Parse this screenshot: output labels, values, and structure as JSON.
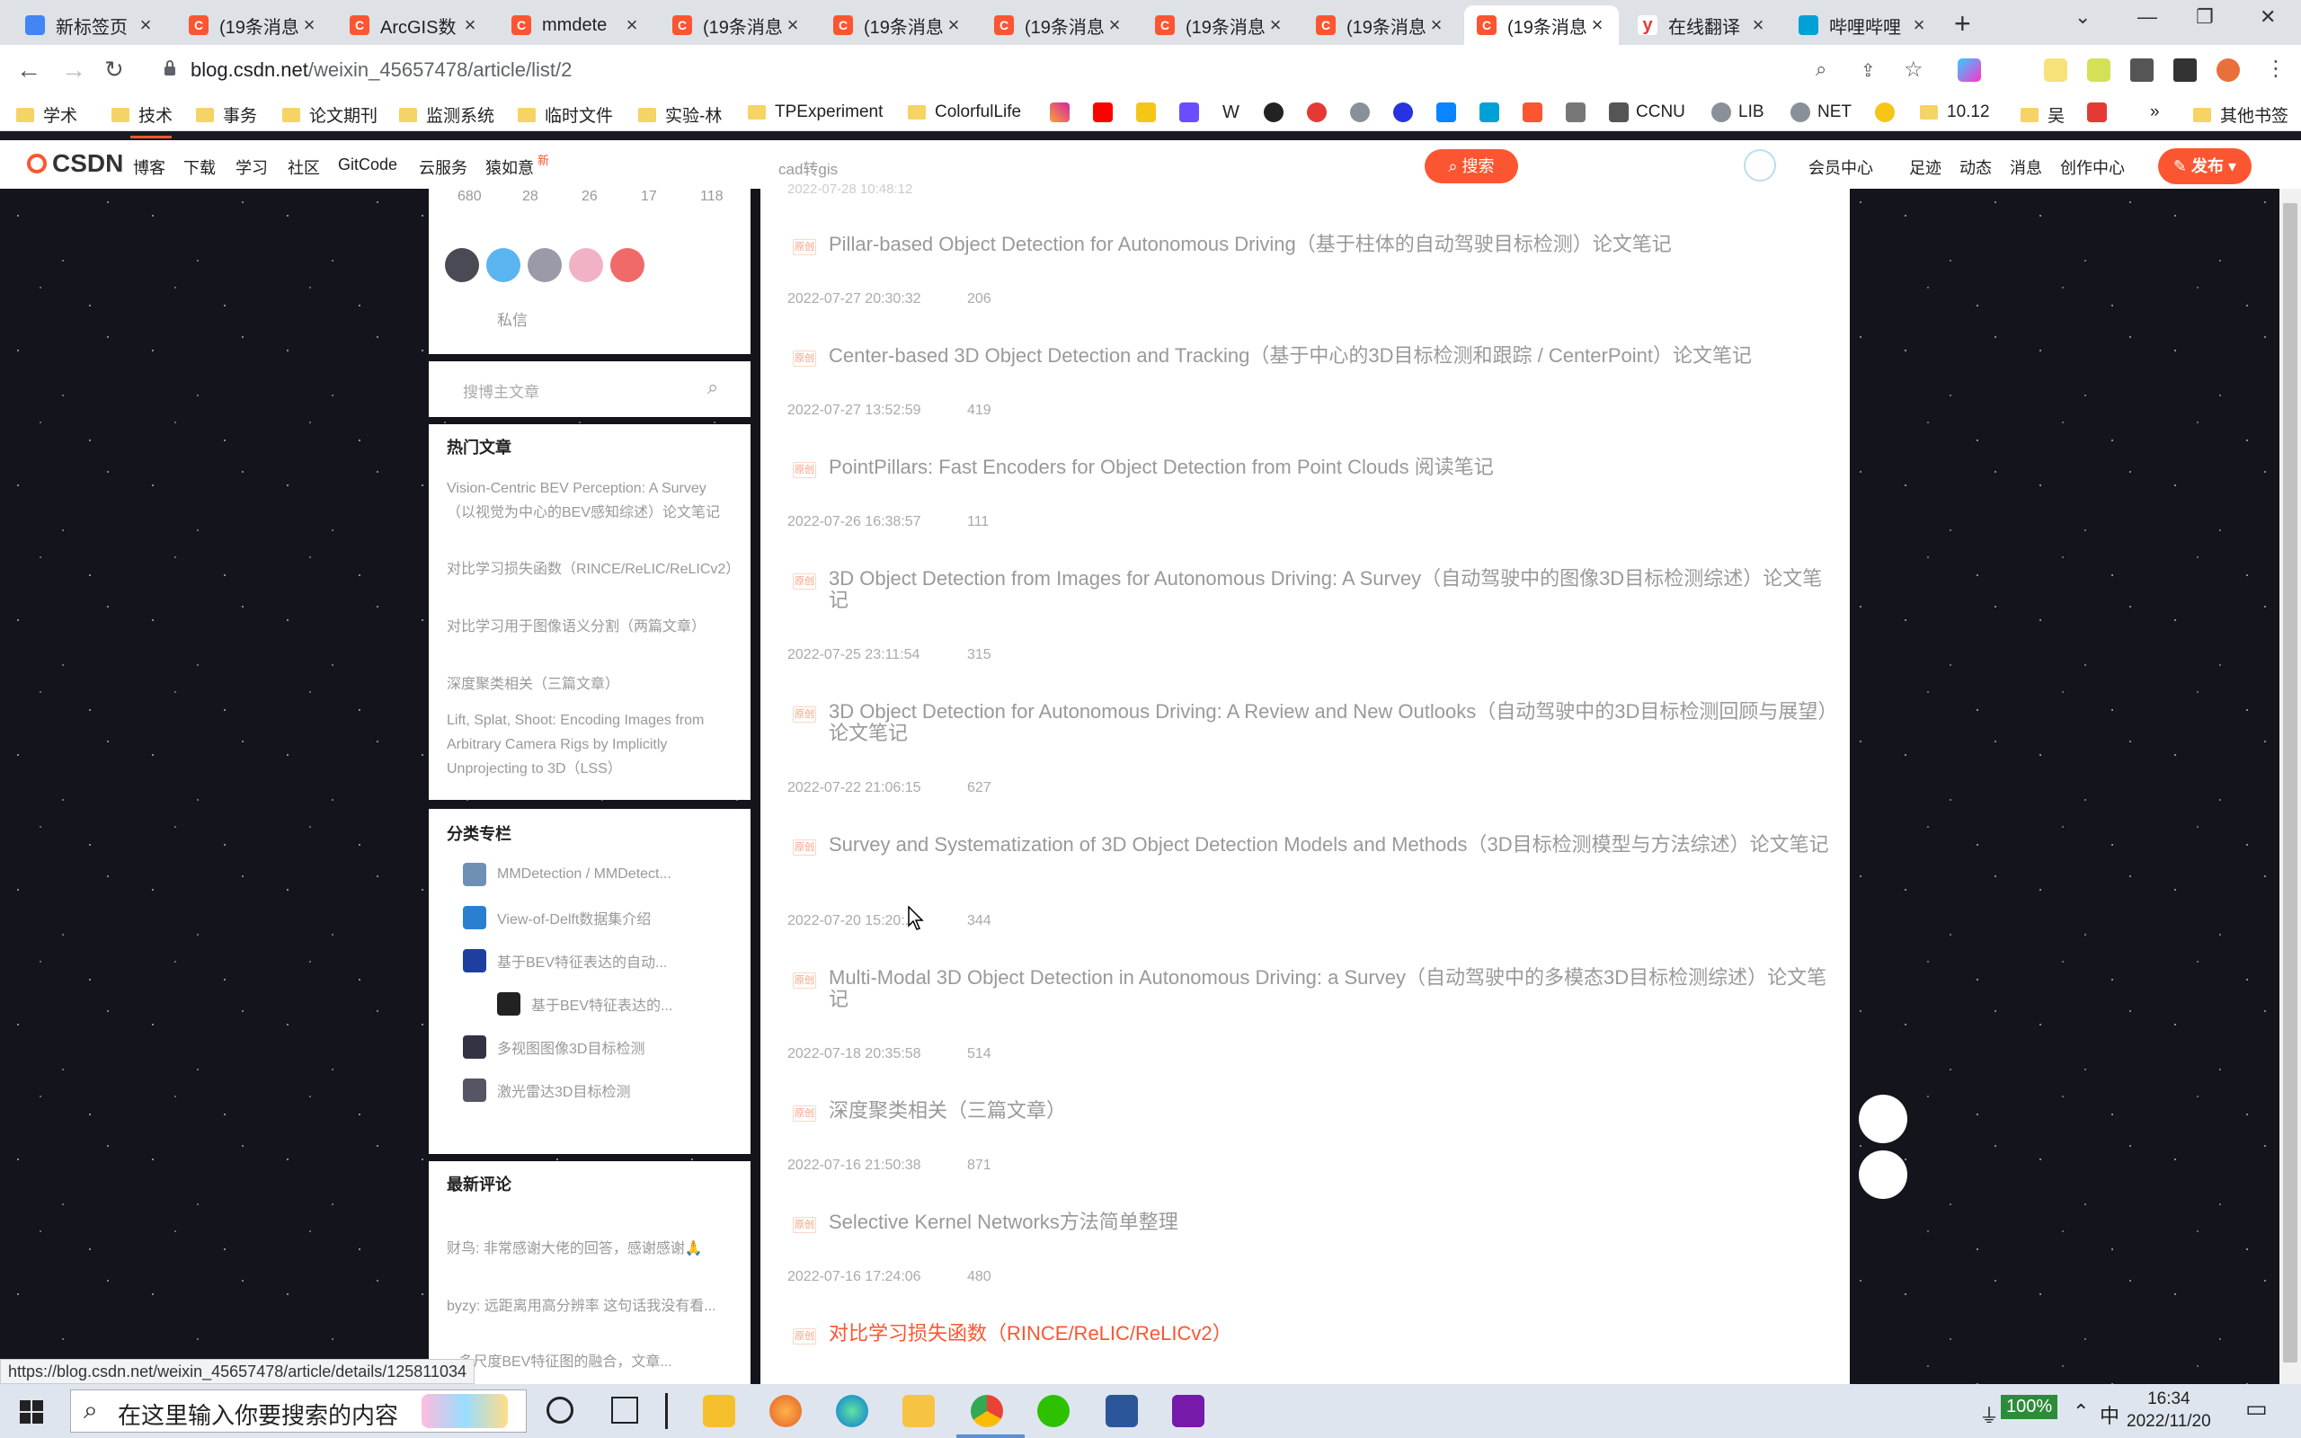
{
  "browser": {
    "tabs": [
      {
        "title": "新标签页",
        "color": "#4285f4",
        "glyph": "◉"
      },
      {
        "title": "(19条消息",
        "color": "#fc5531",
        "glyph": "C"
      },
      {
        "title": "ArcGIS数",
        "color": "#fc5531",
        "glyph": "C"
      },
      {
        "title": "mmdete",
        "color": "#fc5531",
        "glyph": "C"
      },
      {
        "title": "(19条消息",
        "color": "#fc5531",
        "glyph": "C"
      },
      {
        "title": "(19条消息",
        "color": "#fc5531",
        "glyph": "C"
      },
      {
        "title": "(19条消息",
        "color": "#fc5531",
        "glyph": "C"
      },
      {
        "title": "(19条消息",
        "color": "#fc5531",
        "glyph": "C"
      },
      {
        "title": "(19条消息",
        "color": "#fc5531",
        "glyph": "C"
      },
      {
        "title": "(19条消息",
        "color": "#fc5531",
        "glyph": "C"
      },
      {
        "title": "在线翻译",
        "color": "#e53935",
        "glyph": "y"
      },
      {
        "title": "哔哩哔哩",
        "color": "#00a1d6",
        "glyph": "▣"
      }
    ],
    "url_host": "blog.csdn.net",
    "url_path": "/weixin_45657478/article/list/2",
    "bookmarks": [
      "学术",
      "技术",
      "事务",
      "论文期刊",
      "监测系统",
      "临时文件",
      "实验-林",
      "TPExperiment",
      "ColorfulLife"
    ],
    "bookmarks_right": [
      "CCNU",
      "LIB",
      "NET",
      "10.12",
      "吴",
      "其他书签"
    ],
    "status_url": "https://blog.csdn.net/weixin_45657478/article/details/125811034"
  },
  "csdn_header": {
    "logo": "CSDN",
    "nav": [
      "博客",
      "下载",
      "学习",
      "社区",
      "GitCode",
      "云服务",
      "猿如意"
    ],
    "nav_new_badge": "新",
    "search_placeholder": "cad转gis",
    "search_button": "搜索",
    "right": [
      "会员中心",
      "足迹",
      "动态",
      "消息",
      "创作中心"
    ],
    "publish_button": "发布"
  },
  "sidebar": {
    "stats": [
      "680",
      "28",
      "26",
      "17",
      "118"
    ],
    "message_link": "私信",
    "search_placeholder": "搜博主文章",
    "hot_title": "热门文章",
    "hot_articles": [
      "Vision-Centric BEV Perception: A Survey（以视觉为中心的BEV感知综述）论文笔记",
      "对比学习损失函数（RINCE/ReLIC/ReLICv2）",
      "对比学习用于图像语义分割（两篇文章）",
      "深度聚类相关（三篇文章）",
      "Lift, Splat, Shoot: Encoding Images from Arbitrary Camera Rigs by Implicitly Unprojecting to 3D（LSS）"
    ],
    "columns_title": "分类专栏",
    "columns": [
      "MMDetection / MMDetect...",
      "View-of-Delft数据集介绍",
      "基于BEV特征表达的自动...",
      "基于BEV特征表达的...",
      "多视图图像3D目标检测",
      "激光雷达3D目标检测"
    ],
    "comments_title": "最新评论",
    "comments": [
      "财鸟: 非常感谢大佬的回答，感谢感谢🙏",
      "byzy: 远距离用高分辨率 这句话我没有看...",
      "...多尺度BEV特征图的融合，文章..."
    ]
  },
  "articles": [
    {
      "title": "Pillar-based Object Detection for Autonomous Driving（基于柱体的自动驾驶目标检测）论文笔记",
      "date": "2022-07-27 20:30:32",
      "views": "206"
    },
    {
      "title": "Center-based 3D Object Detection and Tracking（基于中心的3D目标检测和跟踪 / CenterPoint）论文笔记",
      "date": "2022-07-27 13:52:59",
      "views": "419"
    },
    {
      "title": "PointPillars: Fast Encoders for Object Detection from Point Clouds 阅读笔记",
      "date": "2022-07-26 16:38:57",
      "views": "111"
    },
    {
      "title": "3D Object Detection from Images for Autonomous Driving: A Survey（自动驾驶中的图像3D目标检测综述）论文笔记",
      "date": "2022-07-25 23:11:54",
      "views": "315"
    },
    {
      "title": "3D Object Detection for Autonomous Driving: A Review and New Outlooks（自动驾驶中的3D目标检测回顾与展望）论文笔记",
      "date": "2022-07-22 21:06:15",
      "views": "627"
    },
    {
      "title": "Survey and Systematization of 3D Object Detection Models and Methods（3D目标检测模型与方法综述）论文笔记",
      "date": "2022-07-20 15:20:...",
      "views": "344"
    },
    {
      "title": "Multi-Modal 3D Object Detection in Autonomous Driving: a Survey（自动驾驶中的多模态3D目标检测综述）论文笔记",
      "date": "2022-07-18 20:35:58",
      "views": "514"
    },
    {
      "title": "深度聚类相关（三篇文章）",
      "date": "2022-07-16 21:50:38",
      "views": "871"
    },
    {
      "title": "Selective Kernel Networks方法简单整理",
      "date": "2022-07-16 17:24:06",
      "views": "480"
    },
    {
      "title": "对比学习损失函数（RINCE/ReLIC/ReLICv2）",
      "date": "",
      "views": ""
    }
  ],
  "article_tag": "原创",
  "taskbar": {
    "search_placeholder": "在这里输入你要搜索的内容",
    "battery": "100%",
    "ime": "中",
    "time": "16:34",
    "date": "2022/11/20"
  }
}
